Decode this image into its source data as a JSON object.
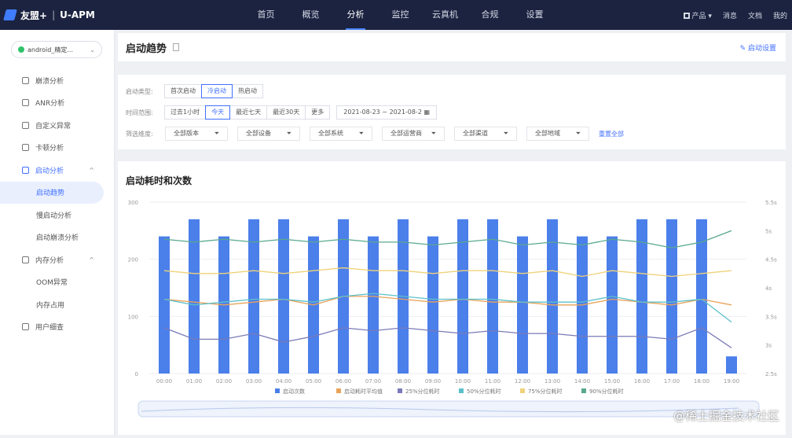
{
  "brand": {
    "name": "友盟+",
    "product": "U-APM"
  },
  "nav": {
    "items": [
      "首页",
      "概览",
      "分析",
      "监控",
      "云真机",
      "合规",
      "设置"
    ],
    "active": "分析"
  },
  "rightnav": {
    "product": "产品",
    "msg": "消息",
    "docs": "文档",
    "user": "我的"
  },
  "sidebar": {
    "app": "android_精定...",
    "items": [
      {
        "label": "崩溃分析",
        "type": "item"
      },
      {
        "label": "ANR分析",
        "type": "item"
      },
      {
        "label": "自定义异常",
        "type": "item"
      },
      {
        "label": "卡顿分析",
        "type": "item"
      },
      {
        "label": "启动分析",
        "type": "group"
      },
      {
        "label": "启动趋势",
        "type": "sub",
        "active": true
      },
      {
        "label": "慢启动分析",
        "type": "sub"
      },
      {
        "label": "启动崩溃分析",
        "type": "sub"
      },
      {
        "label": "内存分析",
        "type": "group2"
      },
      {
        "label": "OOM异常",
        "type": "sub"
      },
      {
        "label": "内存占用",
        "type": "sub"
      },
      {
        "label": "用户细查",
        "type": "item"
      }
    ]
  },
  "header": {
    "title": "启动趋势",
    "settings": "启动设置"
  },
  "filters": {
    "type_label": "启动类型:",
    "types": [
      "首次启动",
      "冷启动",
      "热启动"
    ],
    "type_active": "冷启动",
    "time_label": "时间范围:",
    "times": [
      "过去1小时",
      "今天",
      "最近七天",
      "最近30天",
      "更多"
    ],
    "time_active": "今天",
    "date": "2021-08-23 ~ 2021-08-2",
    "dim_label": "筛选维度:",
    "dims": [
      "全部版本",
      "全部设备",
      "全部系统",
      "全部运营商",
      "全部渠道",
      "全部地域"
    ],
    "reset": "重置全部"
  },
  "chart_data": {
    "type": "bar",
    "title": "启动耗时和次数",
    "categories": [
      "00:00",
      "01:00",
      "02:00",
      "03:00",
      "04:00",
      "05:00",
      "06:00",
      "07:00",
      "08:00",
      "09:00",
      "10:00",
      "11:00",
      "12:00",
      "13:00",
      "14:00",
      "15:00",
      "16:00",
      "17:00",
      "18:00",
      "19:00"
    ],
    "ylim": [
      0,
      300
    ],
    "yticks": [
      0,
      100,
      200,
      300
    ],
    "y2lim": [
      2.5,
      5.5
    ],
    "y2ticks": [
      "2.5s",
      "3s",
      "3.5s",
      "4s",
      "4.5s",
      "5s",
      "5.5s"
    ],
    "bar": {
      "name": "启动次数",
      "color": "#4b7fea",
      "values": [
        240,
        270,
        240,
        270,
        270,
        240,
        270,
        240,
        270,
        240,
        270,
        270,
        240,
        270,
        240,
        240,
        270,
        270,
        270,
        30
      ]
    },
    "series": [
      {
        "name": "启动耗时平均值",
        "color": "#e8a35a",
        "values": [
          3.8,
          3.75,
          3.7,
          3.75,
          3.8,
          3.7,
          3.85,
          3.85,
          3.8,
          3.75,
          3.8,
          3.75,
          3.75,
          3.7,
          3.7,
          3.8,
          3.75,
          3.7,
          3.8,
          3.7
        ]
      },
      {
        "name": "25%分位耗时",
        "color": "#7a7ab8",
        "values": [
          3.3,
          3.1,
          3.1,
          3.2,
          3.05,
          3.15,
          3.3,
          3.25,
          3.3,
          3.25,
          3.2,
          3.25,
          3.2,
          3.2,
          3.15,
          3.15,
          3.15,
          3.1,
          3.3,
          2.95
        ]
      },
      {
        "name": "50%分位耗时",
        "color": "#5bc0c9",
        "values": [
          3.8,
          3.7,
          3.75,
          3.8,
          3.8,
          3.75,
          3.85,
          3.9,
          3.85,
          3.8,
          3.8,
          3.8,
          3.75,
          3.75,
          3.75,
          3.85,
          3.75,
          3.75,
          3.8,
          3.4
        ]
      },
      {
        "name": "75%分位耗时",
        "color": "#f0d27a",
        "values": [
          4.3,
          4.25,
          4.25,
          4.3,
          4.25,
          4.3,
          4.35,
          4.3,
          4.3,
          4.25,
          4.3,
          4.3,
          4.25,
          4.3,
          4.2,
          4.3,
          4.25,
          4.2,
          4.25,
          4.3
        ]
      },
      {
        "name": "90%分位耗时",
        "color": "#58a98e",
        "values": [
          4.85,
          4.8,
          4.85,
          4.8,
          4.85,
          4.8,
          4.85,
          4.8,
          4.8,
          4.75,
          4.8,
          4.85,
          4.75,
          4.8,
          4.75,
          4.85,
          4.8,
          4.7,
          4.8,
          5.0
        ]
      }
    ]
  },
  "watermark": "@稀土掘金技术社区"
}
